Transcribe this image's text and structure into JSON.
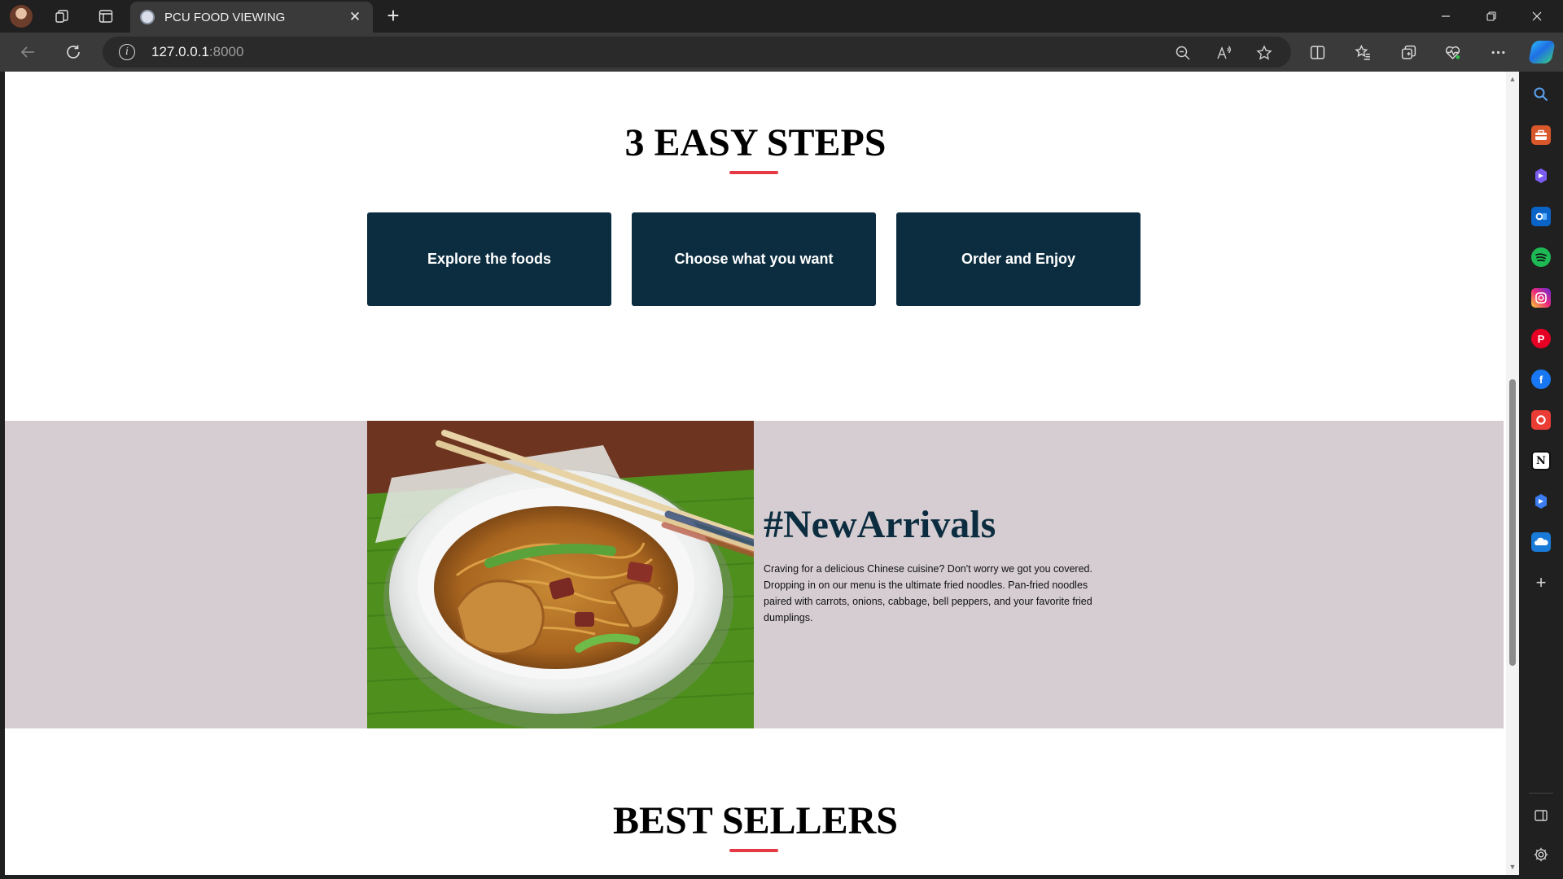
{
  "browser": {
    "tab_title": "PCU FOOD VIEWING",
    "address_host": "127.0.0.1",
    "address_port": ":8000",
    "new_tab_glyph": "+",
    "close_tab_glyph": "✕"
  },
  "page": {
    "steps_heading": "3 EASY STEPS",
    "steps": [
      "Explore the foods",
      "Choose what you want",
      "Order and Enjoy"
    ],
    "new_arrivals": {
      "title": "#NewArrivals",
      "description": "Craving for a delicious Chinese cuisine? Don't worry we got you covered. Dropping in on our menu is the ultimate fried noodles. Pan-fried noodles paired with carrots, onions, cabbage, bell peppers, and your favorite fried dumplings."
    },
    "best_sellers_heading": "BEST SELLERS"
  },
  "colors": {
    "accent_underline": "#e63946",
    "step_card_bg": "#0c2d40",
    "arrivals_bg": "#d5cdd1",
    "arrivals_title": "#0c2d40"
  },
  "sidebar_icons": [
    "search-icon",
    "toolbox-icon",
    "copilot-icon",
    "outlook-icon",
    "spotify-icon",
    "instagram-icon",
    "pinterest-icon",
    "facebook-icon",
    "office-icon",
    "notion-icon",
    "copilot-alt-icon",
    "onedrive-icon",
    "add-icon",
    "sidebar-toggle-icon",
    "settings-icon"
  ]
}
